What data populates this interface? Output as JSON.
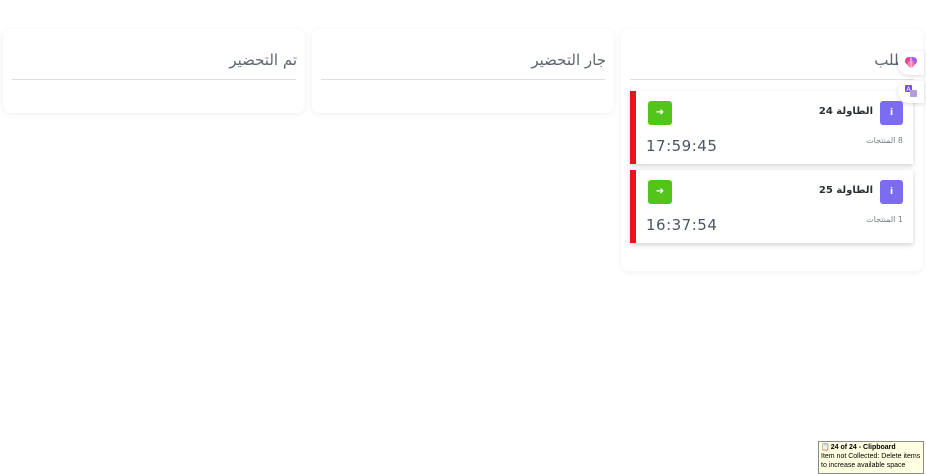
{
  "columns": {
    "ready": {
      "title": "تم التحضير"
    },
    "preparing": {
      "title": "جار التحضير"
    },
    "order": {
      "title": "الطلب",
      "cards": [
        {
          "table": "الطاولة 24",
          "items": "8 المنتجات",
          "timer": "17:59:45",
          "go_icon": "arrow-right-icon",
          "info_icon": "info-icon"
        },
        {
          "table": "الطاولة 25",
          "items": "1 المنتجات",
          "timer": "16:37:54",
          "go_icon": "arrow-right-icon",
          "info_icon": "info-icon"
        }
      ]
    }
  },
  "side_tools": {
    "brain": "brain-icon",
    "translate": "translate-icon"
  },
  "colors": {
    "urgent": "#e8141b",
    "go": "#52c41a",
    "info": "#7c6cf2"
  },
  "tooltip": {
    "title": "24 of 24 - Clipboard",
    "body": "Item not Collected: Delete items to increase available space"
  }
}
